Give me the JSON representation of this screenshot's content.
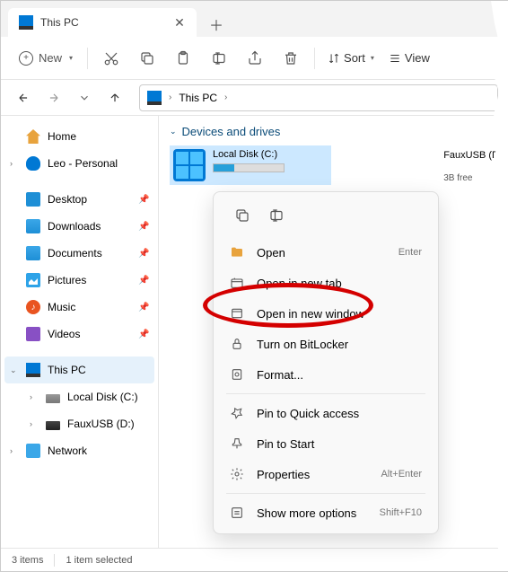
{
  "tab": {
    "title": "This PC"
  },
  "toolbar": {
    "new": "New",
    "sort": "Sort",
    "view": "View"
  },
  "breadcrumb": {
    "location": "This PC"
  },
  "sidebar": {
    "home": "Home",
    "onedrive": "Leo - Personal",
    "quick": [
      {
        "label": "Desktop"
      },
      {
        "label": "Downloads"
      },
      {
        "label": "Documents"
      },
      {
        "label": "Pictures"
      },
      {
        "label": "Music"
      },
      {
        "label": "Videos"
      }
    ],
    "pc": "This PC",
    "drives": [
      {
        "label": "Local Disk (C:)"
      },
      {
        "label": "FauxUSB (D:)"
      }
    ],
    "network": "Network"
  },
  "section": {
    "title": "Devices and drives"
  },
  "drive_c": {
    "name": "Local Disk (C:)"
  },
  "drive_d": {
    "name": "FauxUSB (D:",
    "free": "3B free"
  },
  "context": {
    "open": "Open",
    "open_accel": "Enter",
    "open_tab": "Open in new tab",
    "open_win": "Open in new window",
    "bitlocker": "Turn on BitLocker",
    "format": "Format...",
    "pin_qa": "Pin to Quick access",
    "pin_start": "Pin to Start",
    "props": "Properties",
    "props_accel": "Alt+Enter",
    "more": "Show more options",
    "more_accel": "Shift+F10"
  },
  "status": {
    "items": "3 items",
    "selected": "1 item selected"
  }
}
